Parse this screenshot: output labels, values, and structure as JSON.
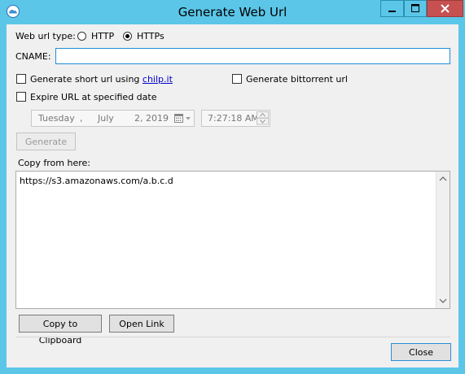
{
  "window": {
    "title": "Generate Web Url"
  },
  "url_type": {
    "label": "Web url type:",
    "options": [
      "HTTP",
      "HTTPs"
    ],
    "selected": "HTTPs"
  },
  "cname": {
    "label": "CNAME:",
    "value": ""
  },
  "short_url": {
    "label": "Generate short url using",
    "link": "chilp.it",
    "checked": false
  },
  "bittorrent": {
    "label": "Generate bittorrent url",
    "checked": false
  },
  "expire": {
    "label": "Expire URL at specified date",
    "checked": false
  },
  "date": {
    "weekday": "Tuesday",
    "sep": ",",
    "month": "July",
    "day_year": "2, 2019"
  },
  "time": {
    "value": "7:27:18 AM"
  },
  "buttons": {
    "generate": "Generate",
    "copy": "Copy to Clipboard",
    "open": "Open Link",
    "close": "Close"
  },
  "output": {
    "label": "Copy from here:",
    "value": "https://s3.amazonaws.com/a.b.c.d"
  },
  "icons": {
    "app": "cloud-icon",
    "minimize": "minimize-icon",
    "maximize": "maximize-icon",
    "close": "close-icon",
    "calendar": "calendar-icon"
  },
  "colors": {
    "titlebar": "#5bc6e8",
    "close_button": "#c75050",
    "focus_border": "#1e8fd6",
    "link": "#0000cc"
  }
}
